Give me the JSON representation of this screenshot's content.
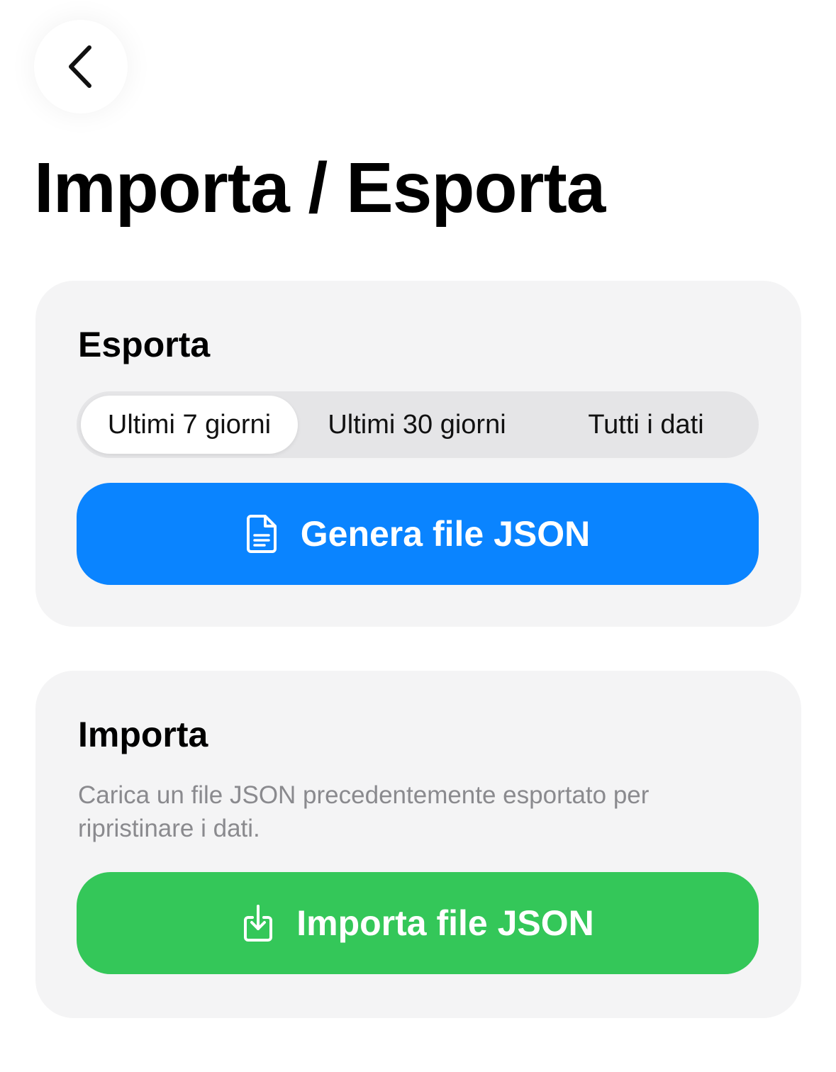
{
  "header": {
    "back_icon": "chevron-left-icon",
    "title": "Importa / Esporta"
  },
  "export_card": {
    "title": "Esporta",
    "segments": [
      {
        "label": "Ultimi 7 giorni",
        "selected": true
      },
      {
        "label": "Ultimi 30 giorni",
        "selected": false
      },
      {
        "label": "Tutti i dati",
        "selected": false
      }
    ],
    "button": {
      "label": "Genera file JSON",
      "icon": "document-icon",
      "color": "#0a84ff"
    }
  },
  "import_card": {
    "title": "Importa",
    "description": "Carica un file JSON precedentemente esportato per ripristinare i dati.",
    "button": {
      "label": "Importa file JSON",
      "icon": "import-tray-icon",
      "color": "#34c759"
    }
  }
}
